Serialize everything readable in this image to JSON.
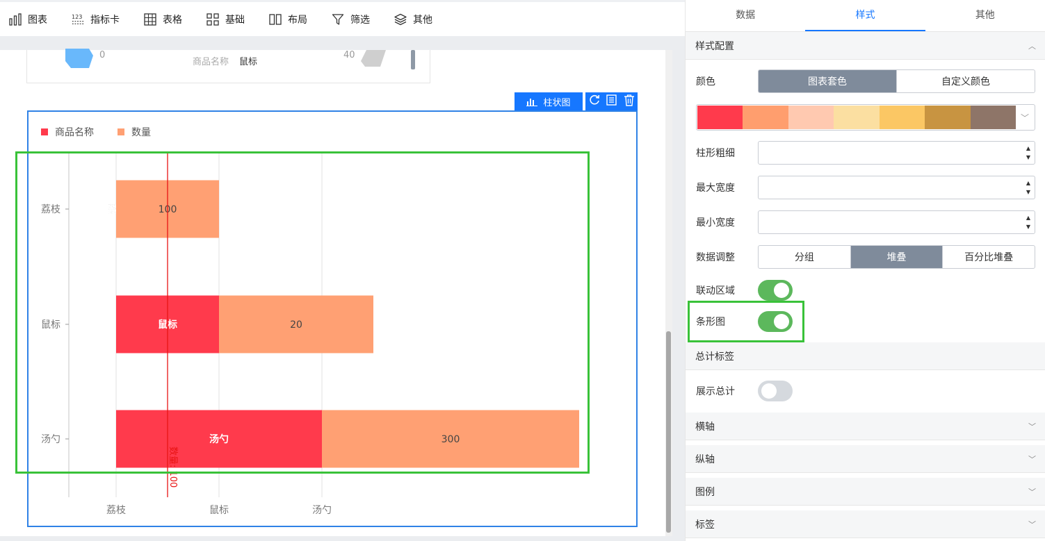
{
  "toolbar": {
    "items": [
      {
        "label": "图表",
        "icon": "bar-chart-icon"
      },
      {
        "label": "指标卡",
        "icon": "number-123-icon"
      },
      {
        "label": "表格",
        "icon": "table-grid-icon"
      },
      {
        "label": "基础",
        "icon": "shapes-icon"
      },
      {
        "label": "布局",
        "icon": "columns-layout-icon"
      },
      {
        "label": "筛选",
        "icon": "filter-funnel-icon"
      },
      {
        "label": "其他",
        "icon": "layers-icon"
      }
    ]
  },
  "top_card": {
    "left_value": "0",
    "right_value": "40",
    "field_label": "商品名称",
    "field_value": "鼠标"
  },
  "chart_toolbar": {
    "type_label": "柱状图"
  },
  "chart_data": {
    "type": "bar",
    "orientation": "horizontal",
    "stacked": true,
    "legend": [
      "商品名称",
      "数量"
    ],
    "legend_position": "top-left",
    "categories": [
      "荔枝",
      "鼠标",
      "汤勺"
    ],
    "x_tick_labels": [
      "荔枝",
      "鼠标",
      "汤勺"
    ],
    "series": [
      {
        "name": "商品名称",
        "color": "#ff3a4c",
        "labels": [
          "荔枝",
          "鼠标",
          "汤勺"
        ],
        "values": [
          0,
          1,
          2
        ]
      },
      {
        "name": "数量",
        "color": "#ffa073",
        "labels": [
          "100",
          "20",
          "300"
        ],
        "values": [
          1,
          1.5,
          2.5
        ]
      }
    ],
    "mark_line": {
      "label": "数量: 100",
      "color": "#e81414",
      "value": 0.5
    },
    "xlim": [
      -0.45,
      4.5
    ],
    "grid": true
  },
  "panel": {
    "tabs": [
      "数据",
      "样式",
      "其他"
    ],
    "active_tab": "样式",
    "style_config": {
      "title": "样式配置",
      "color_label": "颜色",
      "color_options": [
        "图表套色",
        "自定义颜色"
      ],
      "color_active": "图表套色",
      "palette": [
        "#ff3a4c",
        "#ff9e6e",
        "#ffc9b0",
        "#fbdfa1",
        "#fbc764",
        "#c89441",
        "#8e7568"
      ],
      "bar_width_label": "柱形粗细",
      "max_width_label": "最大宽度",
      "min_width_label": "最小宽度",
      "data_adjust_label": "数据调整",
      "data_adjust_options": [
        "分组",
        "堆叠",
        "百分比堆叠"
      ],
      "data_adjust_active": "堆叠",
      "linkage_label": "联动区域",
      "linkage_on": true,
      "bar_chart_label": "条形图",
      "bar_chart_on": true
    },
    "total_label": {
      "title": "总计标签",
      "show_total_label": "展示总计",
      "show_total_on": false
    },
    "collapsed_sections": [
      "横轴",
      "纵轴",
      "图例",
      "标签"
    ]
  }
}
